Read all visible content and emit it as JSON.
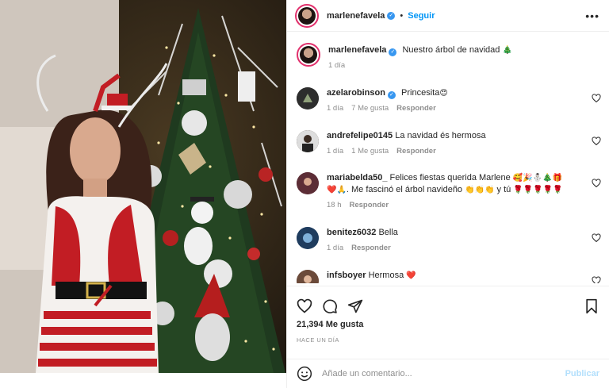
{
  "post": {
    "author": "marlenefavela",
    "follow_label": "Seguir",
    "dot": "•",
    "more_label": "•••",
    "caption_text": "Nuestro árbol de navidad",
    "caption_emoji": "🎄",
    "caption_time": "1 día"
  },
  "comments": [
    {
      "user": "azelarobinson",
      "verified": true,
      "text": "Princesita",
      "emoji": "😍",
      "time": "1 día",
      "likes": "7 Me gusta",
      "reply": "Responder",
      "avatar_color": "#3a3a3a"
    },
    {
      "user": "andrefelipe0145",
      "verified": false,
      "text": "La navidad és hermosa",
      "emoji": "",
      "time": "1 día",
      "likes": "1 Me gusta",
      "reply": "Responder",
      "avatar_color": "#5a4e44"
    },
    {
      "user": "mariabelda50_",
      "verified": false,
      "text": "Felices fiestas querida Marlene",
      "emoji": "🥰🎉⛄🎄🎁",
      "text2_prefix": "❤️🙏",
      "text2": ". Me fascinó el árbol navideño",
      "emoji2": "👏👏👏",
      "text3": "y tú",
      "emoji3": "🌹🌹🌹🌹🌹",
      "time": "18 h",
      "likes": "",
      "reply": "Responder",
      "avatar_color": "#6b3a44"
    },
    {
      "user": "benitez6032",
      "verified": false,
      "text": "Bella",
      "emoji": "",
      "time": "1 día",
      "likes": "",
      "reply": "Responder",
      "avatar_color": "#2f4e73"
    },
    {
      "user": "infsboyer",
      "verified": false,
      "text": "Hermosa",
      "emoji": "❤️",
      "time": "",
      "likes": "",
      "reply": "",
      "avatar_color": "#7b5a48"
    }
  ],
  "actions": {
    "likes_count": "21,394 Me gusta",
    "posted_when": "HACE UN DÍA"
  },
  "add_comment": {
    "placeholder": "Añade un comentario...",
    "publish_label": "Publicar"
  },
  "colors": {
    "accent": "#0095f6",
    "verified": "#3897f0",
    "secondary_text": "#8e8e8e"
  }
}
